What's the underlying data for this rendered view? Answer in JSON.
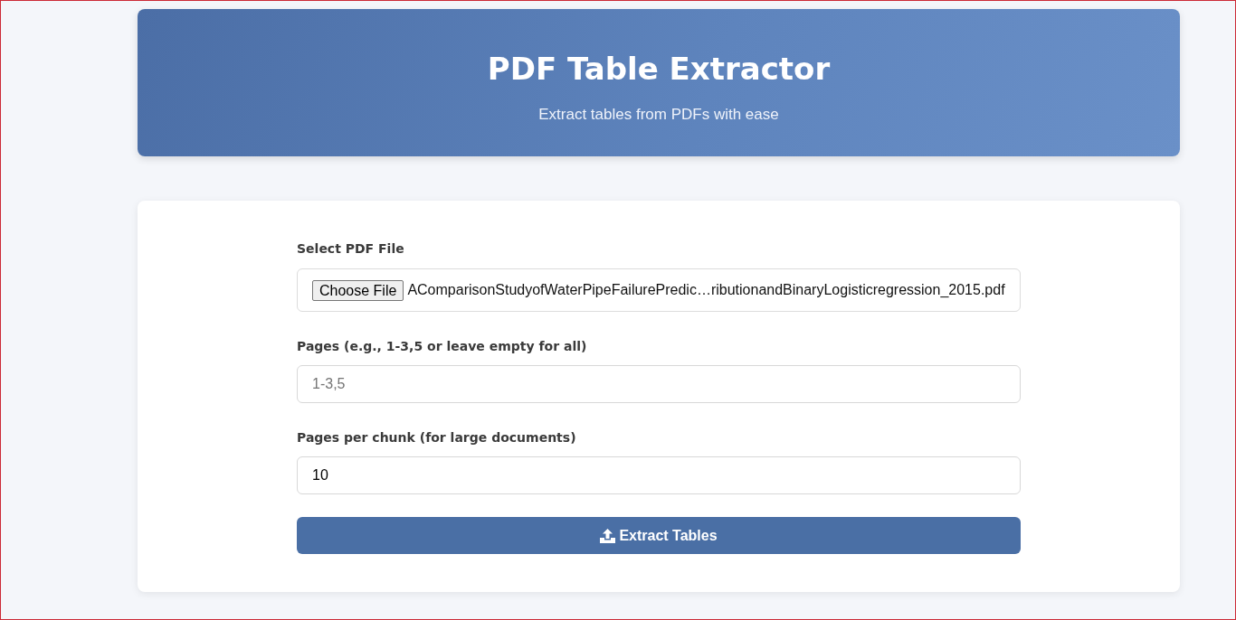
{
  "header": {
    "title": "PDF Table Extractor",
    "subtitle": "Extract tables from PDFs with ease"
  },
  "form": {
    "fields": [
      {
        "kind": "file",
        "label": "Select PDF File",
        "button": "Choose File",
        "value": "AComparisonStudyofWaterPipeFailurePredic…ributionandBinaryLogisticregression_2015.pdf"
      },
      {
        "kind": "text",
        "label": "Pages (e.g., 1-3,5 or leave empty for all)",
        "placeholder": "1-3,5"
      },
      {
        "kind": "text",
        "label": "Pages per chunk (for large documents)",
        "value": "10"
      }
    ],
    "submit": {
      "label": "Extract Tables"
    }
  }
}
